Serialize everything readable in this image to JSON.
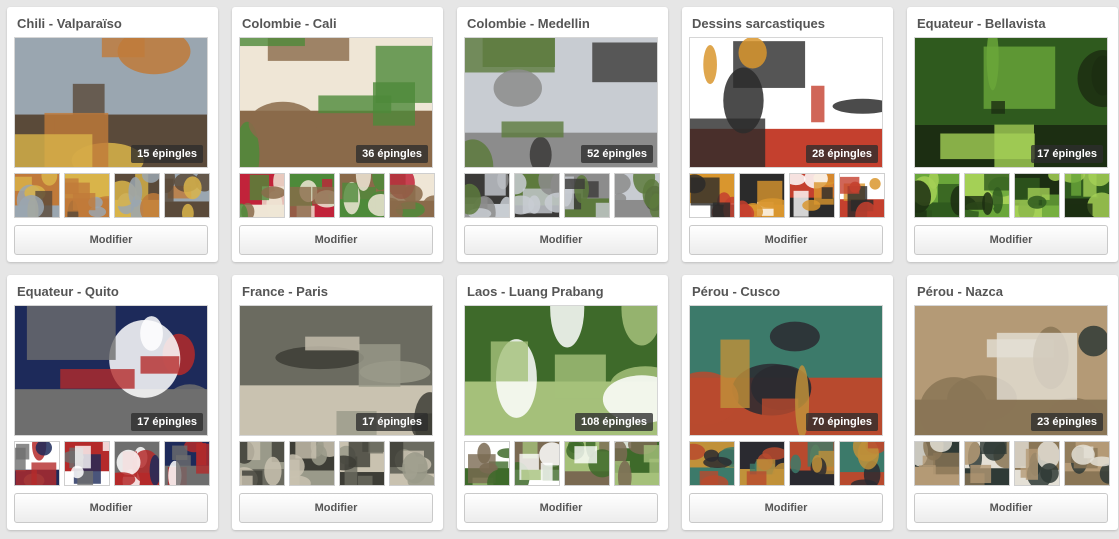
{
  "boards": [
    {
      "title": "Chili - Valparaïso",
      "pins": "15 épingles",
      "modify": "Modifier",
      "palette": [
        "#9aa6b0",
        "#c07a3a",
        "#d9b44a",
        "#5a4a3a"
      ]
    },
    {
      "title": "Colombie - Cali",
      "pins": "36 épingles",
      "modify": "Modifier",
      "palette": [
        "#efe6d6",
        "#c1233a",
        "#4d8a3a",
        "#8a6a4a"
      ]
    },
    {
      "title": "Colombie - Medellin",
      "pins": "52 épingles",
      "modify": "Modifier",
      "palette": [
        "#c8ccd2",
        "#3b3a38",
        "#5d7a3d",
        "#8c8c8c"
      ]
    },
    {
      "title": "Dessins sarcastiques",
      "pins": "28 épingles",
      "modify": "Modifier",
      "palette": [
        "#ffffff",
        "#d9962e",
        "#2b2b2b",
        "#c4402e"
      ]
    },
    {
      "title": "Equateur - Bellavista",
      "pins": "17 épingles",
      "modify": "Modifier",
      "palette": [
        "#2f5a1e",
        "#6aa63a",
        "#a4d056",
        "#1c2e12"
      ]
    },
    {
      "title": "Equateur - Quito",
      "pins": "17 épingles",
      "modify": "Modifier",
      "palette": [
        "#1d2a5a",
        "#ffffff",
        "#b42a2a",
        "#6e6e6e"
      ]
    },
    {
      "title": "France - Paris",
      "pins": "17 épingles",
      "modify": "Modifier",
      "palette": [
        "#6b6b60",
        "#9a9a8a",
        "#3d3d36",
        "#c9c2b0"
      ]
    },
    {
      "title": "Laos - Luang Prabang",
      "pins": "108 épingles",
      "modify": "Modifier",
      "palette": [
        "#3e6a2a",
        "#ffffff",
        "#7a6a52",
        "#a5c07a"
      ]
    },
    {
      "title": "Pérou - Cusco",
      "pins": "70 épingles",
      "modify": "Modifier",
      "palette": [
        "#3c7a6a",
        "#c0913a",
        "#2a2a30",
        "#b84a2e"
      ]
    },
    {
      "title": "Pérou - Nazca",
      "pins": "23 épingles",
      "modify": "Modifier",
      "palette": [
        "#b49a76",
        "#2f3a36",
        "#e4e0d6",
        "#8a7656"
      ]
    }
  ],
  "icons": {
    "cover-photo": "photo-icon",
    "thumbnail": "photo-icon"
  }
}
